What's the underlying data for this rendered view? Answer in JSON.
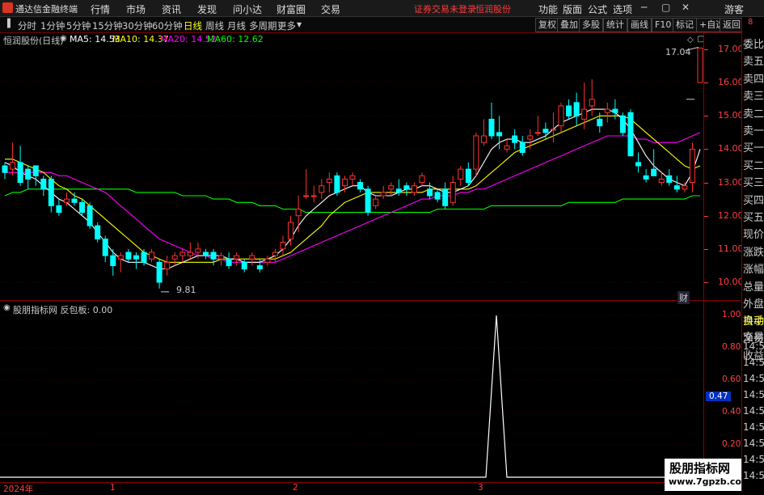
{
  "app": {
    "title": "通达信金融终端",
    "logo_icon": "tdx-logo-icon"
  },
  "menu": [
    "行情",
    "市场",
    "资讯",
    "发现",
    "问小达",
    "财富圈",
    "交易"
  ],
  "status": {
    "trade_status": "证券交易未登录",
    "stock_name": "恒润股份"
  },
  "right_menu": [
    "功能",
    "版面",
    "公式",
    "选项"
  ],
  "user": "游客",
  "periods": [
    "分时",
    "1分钟",
    "5分钟",
    "15分钟",
    "30分钟",
    "60分钟",
    "日线",
    "周线",
    "月线",
    "多周期",
    "更多"
  ],
  "active_period": "日线",
  "toolbar_buttons": [
    "复权",
    "叠加",
    "多股",
    "统计",
    "画线",
    "F10",
    "标记",
    "+自选",
    "返回"
  ],
  "chart_title": "恒润股份(日线)",
  "ma": {
    "ma5": "MA5: 14.53",
    "ma10": "MA10: 14.37",
    "ma20": "MA20: 14.52",
    "ma60": "MA60: 12.62",
    "colors": {
      "ma5": "#ffffff",
      "ma10": "#ffff00",
      "ma20": "#ff00ff",
      "ma60": "#00ff00"
    }
  },
  "annotations": {
    "high": "17.04",
    "low": "9.81",
    "fin": "财"
  },
  "sub_indicator": {
    "legend": "股朋指标网 反包板: 0.00",
    "value_marker": "0.47"
  },
  "price_ticks": [
    "17.00",
    "16.00",
    "15.00",
    "14.00",
    "13.00",
    "12.00",
    "11.00",
    "10.00"
  ],
  "sub_ticks": [
    "1.00",
    "0.80",
    "0.60",
    "0.40",
    "0.20"
  ],
  "time_labels": [
    "2024年",
    "1",
    "2",
    "3"
  ],
  "right_panel": [
    "委比",
    "卖五",
    "卖四",
    "卖三",
    "卖二",
    "卖一",
    "买一",
    "买二",
    "买三",
    "买四",
    "买五",
    "现价",
    "涨跌",
    "涨幅",
    "总量",
    "外盘",
    "换手",
    "净资",
    "收益",
    "自动",
    "交易"
  ],
  "right_times": [
    "14:56",
    "14:56",
    "14:56",
    "14:56",
    "14:56",
    "14:56",
    "14:56",
    "14:56",
    "14:56"
  ],
  "watermark": {
    "line1": "股朋指标网",
    "line2": "www.7gpzb.com"
  },
  "colors": {
    "up": "#ff3232",
    "down": "#00ffff",
    "axis": "#ff4040",
    "frame": "#8b0000"
  },
  "chart_data": {
    "type": "candlestick",
    "y_range": [
      9.6,
      17.6
    ],
    "candles": [
      [
        13.5,
        13.6,
        13.1,
        13.3
      ],
      [
        13.4,
        14.2,
        13.2,
        13.6
      ],
      [
        13.6,
        14.1,
        12.9,
        13.0
      ],
      [
        13.4,
        13.5,
        12.8,
        13.1
      ],
      [
        13.5,
        13.5,
        12.9,
        13.2
      ],
      [
        13.1,
        13.2,
        12.6,
        12.8
      ],
      [
        13.1,
        13.2,
        12.1,
        12.3
      ],
      [
        12.3,
        12.5,
        12.0,
        12.1
      ],
      [
        12.4,
        12.7,
        12.3,
        12.5
      ],
      [
        12.5,
        12.7,
        12.3,
        12.4
      ],
      [
        12.4,
        12.5,
        12.0,
        12.1
      ],
      [
        12.3,
        12.4,
        11.6,
        11.7
      ],
      [
        11.7,
        11.8,
        11.2,
        11.3
      ],
      [
        11.3,
        11.4,
        10.6,
        10.8
      ],
      [
        10.8,
        11.0,
        10.2,
        10.5
      ],
      [
        10.7,
        10.9,
        10.3,
        10.8
      ],
      [
        10.9,
        11.0,
        10.6,
        10.7
      ],
      [
        10.8,
        10.9,
        10.4,
        10.7
      ],
      [
        10.9,
        11.0,
        10.5,
        10.6
      ],
      [
        10.7,
        11.0,
        10.6,
        10.9
      ],
      [
        10.6,
        10.7,
        9.81,
        10.0
      ],
      [
        10.4,
        10.8,
        10.2,
        10.6
      ],
      [
        10.7,
        10.9,
        10.5,
        10.8
      ],
      [
        10.8,
        11.0,
        10.6,
        10.9
      ],
      [
        10.8,
        11.2,
        10.7,
        10.9
      ],
      [
        10.9,
        11.2,
        10.7,
        11.0
      ],
      [
        10.9,
        11.0,
        10.7,
        10.8
      ],
      [
        10.9,
        11.0,
        10.5,
        10.7
      ],
      [
        10.7,
        10.9,
        10.5,
        10.8
      ],
      [
        10.7,
        10.9,
        10.4,
        10.5
      ],
      [
        10.7,
        10.9,
        10.5,
        10.8
      ],
      [
        10.6,
        10.7,
        10.3,
        10.4
      ],
      [
        10.7,
        10.9,
        10.5,
        10.8
      ],
      [
        10.5,
        10.7,
        10.3,
        10.4
      ],
      [
        10.6,
        10.8,
        10.5,
        10.7
      ],
      [
        10.8,
        11.0,
        10.6,
        10.9
      ],
      [
        11.0,
        11.4,
        10.8,
        11.2
      ],
      [
        11.3,
        12.0,
        11.1,
        11.8
      ],
      [
        12.0,
        12.6,
        11.5,
        12.2
      ],
      [
        12.6,
        13.4,
        12.5,
        12.6
      ],
      [
        12.6,
        12.9,
        12.4,
        12.6
      ],
      [
        12.7,
        13.1,
        12.5,
        12.9
      ],
      [
        13.0,
        13.3,
        12.7,
        13.1
      ],
      [
        13.2,
        13.3,
        12.6,
        12.7
      ],
      [
        12.9,
        13.2,
        12.7,
        13.1
      ],
      [
        13.1,
        13.3,
        12.9,
        13.2
      ],
      [
        13.0,
        13.1,
        12.7,
        12.8
      ],
      [
        12.8,
        12.9,
        12.0,
        12.1
      ],
      [
        12.3,
        12.6,
        12.2,
        12.5
      ],
      [
        12.6,
        12.9,
        12.5,
        12.7
      ],
      [
        12.8,
        13.0,
        12.6,
        12.9
      ],
      [
        12.8,
        13.1,
        12.6,
        12.7
      ],
      [
        12.9,
        13.0,
        12.6,
        12.8
      ],
      [
        12.7,
        13.0,
        12.6,
        12.9
      ],
      [
        13.0,
        13.3,
        12.9,
        13.2
      ],
      [
        12.8,
        13.0,
        12.5,
        12.6
      ],
      [
        12.7,
        12.8,
        12.4,
        12.5
      ],
      [
        12.8,
        13.0,
        12.2,
        12.3
      ],
      [
        12.4,
        13.2,
        12.3,
        13.0
      ],
      [
        13.1,
        13.5,
        12.9,
        13.4
      ],
      [
        13.4,
        13.6,
        12.9,
        13.0
      ],
      [
        13.4,
        14.5,
        13.2,
        14.4
      ],
      [
        14.2,
        14.9,
        14.1,
        14.4
      ],
      [
        14.9,
        15.4,
        14.3,
        14.4
      ],
      [
        14.5,
        15.0,
        14.0,
        14.4
      ],
      [
        14.0,
        14.3,
        13.9,
        14.1
      ],
      [
        14.4,
        14.6,
        14.0,
        14.2
      ],
      [
        14.2,
        14.4,
        13.8,
        13.9
      ],
      [
        14.3,
        14.6,
        14.0,
        14.4
      ],
      [
        14.5,
        15.0,
        14.4,
        14.5
      ],
      [
        14.6,
        14.8,
        14.3,
        14.5
      ],
      [
        14.6,
        15.1,
        14.2,
        14.6
      ],
      [
        14.7,
        15.4,
        14.5,
        15.3
      ],
      [
        15.3,
        15.5,
        14.9,
        15.0
      ],
      [
        15.4,
        15.7,
        14.7,
        15.0
      ],
      [
        14.9,
        16.0,
        14.6,
        15.2
      ],
      [
        15.3,
        16.1,
        15.0,
        15.5
      ],
      [
        14.9,
        15.1,
        14.5,
        14.7
      ],
      [
        15.1,
        15.4,
        14.8,
        15.2
      ],
      [
        15.2,
        15.5,
        14.9,
        15.1
      ],
      [
        15.0,
        15.1,
        14.4,
        14.5
      ],
      [
        15.1,
        15.2,
        13.8,
        13.8
      ],
      [
        13.6,
        13.9,
        13.3,
        13.5
      ],
      [
        13.2,
        13.4,
        13.0,
        13.1
      ],
      [
        13.4,
        14.0,
        13.2,
        13.2
      ],
      [
        13.0,
        13.3,
        12.9,
        13.1
      ],
      [
        13.2,
        13.4,
        12.9,
        13.0
      ],
      [
        12.9,
        13.2,
        12.7,
        12.8
      ],
      [
        12.8,
        13.0,
        12.7,
        12.9
      ],
      [
        13.0,
        14.2,
        12.7,
        14.0
      ],
      [
        16.0,
        17.04,
        16.0,
        17.04
      ]
    ],
    "ma5": [
      13.6,
      13.5,
      13.3,
      13.2,
      13.1,
      12.9,
      12.7,
      12.5,
      12.4,
      12.2,
      12.0,
      11.8,
      11.5,
      11.2,
      10.9,
      10.7,
      10.6,
      10.6,
      10.6,
      10.5,
      10.4,
      10.4,
      10.5,
      10.6,
      10.7,
      10.8,
      10.8,
      10.8,
      10.8,
      10.7,
      10.7,
      10.6,
      10.6,
      10.6,
      10.7,
      10.8,
      11.0,
      11.3,
      11.7,
      12.0,
      12.2,
      12.4,
      12.6,
      12.7,
      12.8,
      12.9,
      12.9,
      12.7,
      12.6,
      12.6,
      12.6,
      12.7,
      12.8,
      12.8,
      12.9,
      12.9,
      12.8,
      12.7,
      12.7,
      12.8,
      12.9,
      13.2,
      13.6,
      14.0,
      14.2,
      14.3,
      14.3,
      14.2,
      14.2,
      14.3,
      14.4,
      14.6,
      14.8,
      14.9,
      15.0,
      15.1,
      15.2,
      15.2,
      15.2,
      15.1,
      14.9,
      14.6,
      14.2,
      13.8,
      13.5,
      13.3,
      13.1,
      13.0,
      12.9,
      13.3,
      14.0
    ],
    "ma10": [
      13.7,
      13.7,
      13.6,
      13.5,
      13.4,
      13.3,
      13.1,
      12.9,
      12.8,
      12.6,
      12.5,
      12.3,
      12.1,
      11.9,
      11.7,
      11.5,
      11.3,
      11.1,
      10.9,
      10.8,
      10.7,
      10.6,
      10.6,
      10.6,
      10.6,
      10.6,
      10.6,
      10.6,
      10.7,
      10.7,
      10.7,
      10.7,
      10.7,
      10.7,
      10.7,
      10.7,
      10.8,
      10.9,
      11.1,
      11.3,
      11.5,
      11.7,
      12.0,
      12.2,
      12.4,
      12.5,
      12.6,
      12.7,
      12.7,
      12.7,
      12.7,
      12.7,
      12.7,
      12.7,
      12.7,
      12.8,
      12.8,
      12.8,
      12.8,
      12.8,
      12.8,
      12.9,
      13.1,
      13.3,
      13.5,
      13.7,
      13.9,
      14.0,
      14.1,
      14.2,
      14.3,
      14.4,
      14.5,
      14.6,
      14.7,
      14.8,
      14.9,
      15.0,
      15.0,
      15.0,
      15.0,
      14.9,
      14.7,
      14.5,
      14.3,
      14.1,
      13.9,
      13.7,
      13.5,
      13.4,
      13.5
    ],
    "ma20": [
      13.3,
      13.3,
      13.3,
      13.3,
      13.3,
      13.3,
      13.3,
      13.2,
      13.2,
      13.1,
      13.0,
      12.9,
      12.8,
      12.7,
      12.5,
      12.3,
      12.1,
      11.9,
      11.7,
      11.5,
      11.3,
      11.2,
      11.1,
      11.0,
      10.9,
      10.8,
      10.8,
      10.7,
      10.7,
      10.6,
      10.6,
      10.6,
      10.6,
      10.6,
      10.6,
      10.6,
      10.7,
      10.8,
      10.9,
      11.0,
      11.1,
      11.2,
      11.3,
      11.4,
      11.5,
      11.6,
      11.7,
      11.8,
      11.9,
      12.0,
      12.1,
      12.2,
      12.3,
      12.4,
      12.5,
      12.5,
      12.6,
      12.6,
      12.6,
      12.7,
      12.7,
      12.8,
      12.8,
      12.9,
      13.0,
      13.1,
      13.2,
      13.3,
      13.4,
      13.5,
      13.6,
      13.7,
      13.8,
      13.9,
      14.0,
      14.1,
      14.2,
      14.3,
      14.4,
      14.4,
      14.4,
      14.4,
      14.3,
      14.3,
      14.2,
      14.2,
      14.2,
      14.2,
      14.3,
      14.4,
      14.5
    ],
    "ma60": [
      12.6,
      12.7,
      12.7,
      12.8,
      12.8,
      12.8,
      12.8,
      12.8,
      12.8,
      12.8,
      12.8,
      12.8,
      12.8,
      12.8,
      12.8,
      12.8,
      12.8,
      12.7,
      12.7,
      12.7,
      12.7,
      12.7,
      12.7,
      12.6,
      12.6,
      12.6,
      12.6,
      12.5,
      12.5,
      12.5,
      12.4,
      12.4,
      12.4,
      12.3,
      12.3,
      12.3,
      12.2,
      12.2,
      12.2,
      12.1,
      12.1,
      12.1,
      12.1,
      12.1,
      12.1,
      12.1,
      12.1,
      12.1,
      12.1,
      12.1,
      12.1,
      12.1,
      12.1,
      12.1,
      12.1,
      12.1,
      12.2,
      12.2,
      12.2,
      12.2,
      12.2,
      12.2,
      12.2,
      12.3,
      12.3,
      12.3,
      12.3,
      12.3,
      12.3,
      12.3,
      12.3,
      12.3,
      12.3,
      12.4,
      12.4,
      12.4,
      12.4,
      12.4,
      12.4,
      12.4,
      12.5,
      12.5,
      12.5,
      12.5,
      12.5,
      12.5,
      12.5,
      12.5,
      12.5,
      12.6,
      12.6
    ],
    "sub_values_range": [
      0,
      1.2
    ],
    "sub_spike_index": 52,
    "sub_spike_value": 1.0
  }
}
